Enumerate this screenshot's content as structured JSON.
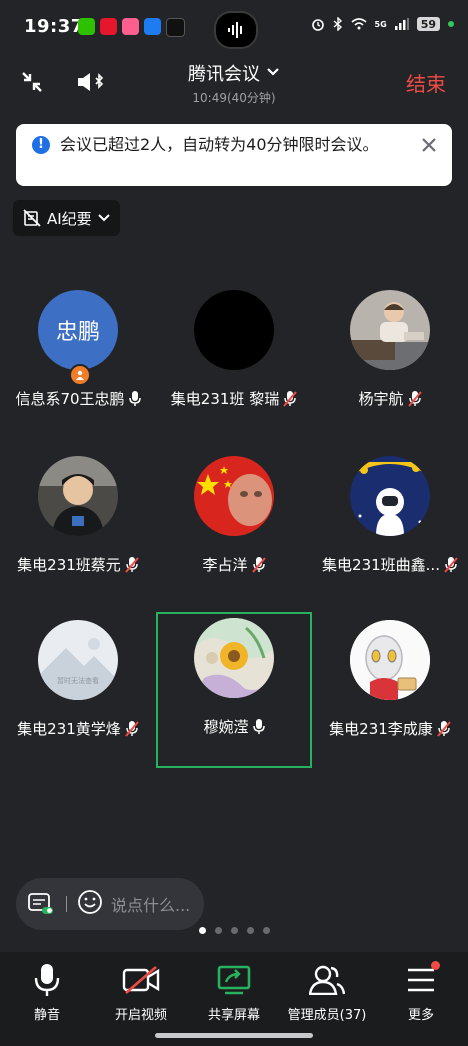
{
  "status_bar": {
    "time": "19:37",
    "battery": "59",
    "network": "5G"
  },
  "header": {
    "title": "腾讯会议",
    "subtitle": "10:49(40分钟)",
    "end_label": "结束"
  },
  "notice": {
    "text": "会议已超过2人，自动转为40分钟限时会议。"
  },
  "ai_summary": {
    "label": "AI纪要"
  },
  "participants": [
    {
      "name": "信息系70王忠鹏",
      "avatar_text": "忠鹏",
      "mic": "on",
      "host": true
    },
    {
      "name": "集电231班 黎瑞",
      "mic": "muted"
    },
    {
      "name": "杨宇航",
      "mic": "muted"
    },
    {
      "name": "集电231班蔡元",
      "mic": "muted"
    },
    {
      "name": "李占洋",
      "mic": "muted"
    },
    {
      "name": "集电231班曲鑫...",
      "mic": "muted"
    },
    {
      "name": "集电231黄学烽",
      "mic": "muted",
      "avatar_caption": "暂时无法查看"
    },
    {
      "name": "穆婉滢",
      "mic": "on",
      "active": true
    },
    {
      "name": "集电231李成康",
      "mic": "muted"
    }
  ],
  "comment": {
    "placeholder": "说点什么..."
  },
  "pagination": {
    "pages": 5,
    "current": 1
  },
  "toolbar": {
    "mute": "静音",
    "video": "开启视频",
    "share": "共享屏幕",
    "members": "管理成员(37)",
    "more": "更多"
  },
  "colors": {
    "accent_green": "#27b35d",
    "end_red": "#ef4b46",
    "info_blue": "#1f6fe6"
  }
}
